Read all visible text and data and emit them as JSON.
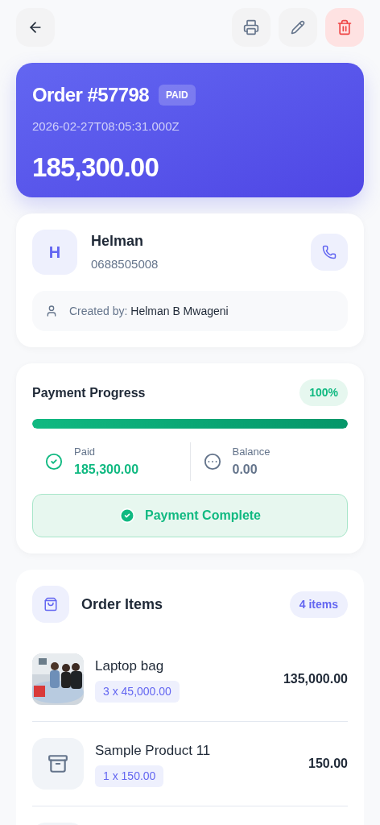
{
  "order": {
    "title": "Order #57798",
    "status": "PAID",
    "timestamp": "2026-02-27T08:05:31.000Z",
    "total": "185,300.00"
  },
  "customer": {
    "initial": "H",
    "name": "Helman",
    "phone": "0688505008",
    "created_label": "Created by:",
    "created_by": "Helman B Mwageni"
  },
  "payment": {
    "title": "Payment Progress",
    "percent": "100%",
    "level": 1,
    "paid_label": "Paid",
    "paid": "185,300.00",
    "balance_label": "Balance",
    "balance": "0.00",
    "complete": true,
    "complete_label": "Payment Complete"
  },
  "items_section": {
    "title": "Order Items",
    "count": "4 items",
    "items": [
      {
        "name": "Laptop bag",
        "qty": "3 x 45,000.00",
        "total": "135,000.00"
      },
      {
        "kind": "box",
        "name": "Sample Product 11",
        "qty": "1 x 150.00",
        "total": "150.00"
      },
      {
        "kind": "tile"
      }
    ]
  }
}
